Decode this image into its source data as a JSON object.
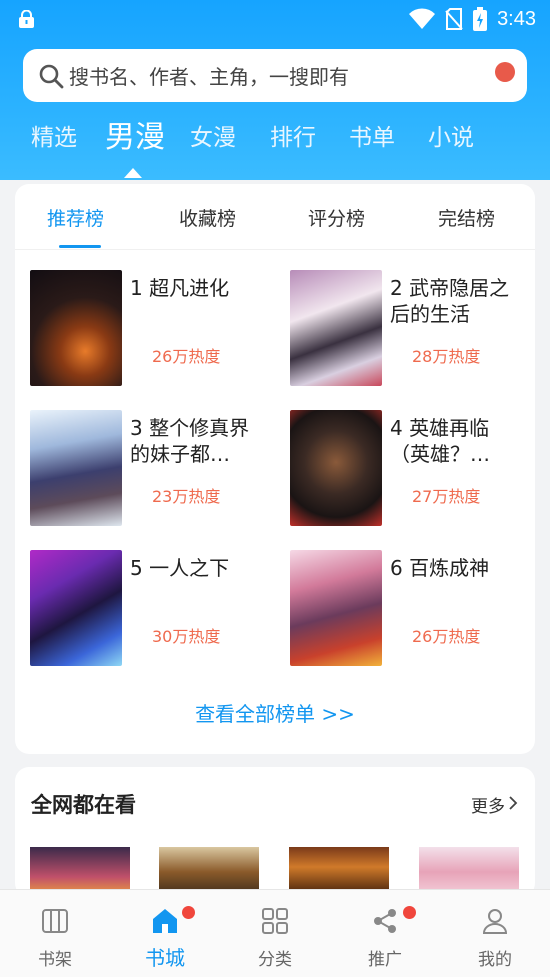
{
  "status_bar": {
    "time": "3:43"
  },
  "search": {
    "placeholder": "搜书名、作者、主角，一搜即有"
  },
  "top_tabs": [
    "精选",
    "男漫",
    "女漫",
    "排行",
    "书单",
    "小说"
  ],
  "rank_tabs": [
    "推荐榜",
    "收藏榜",
    "评分榜",
    "完结榜"
  ],
  "books": [
    {
      "rank": "1",
      "title": "超凡进化",
      "heat": "26万热度"
    },
    {
      "rank": "2",
      "title": "武帝隐居之后的生活",
      "heat": "28万热度"
    },
    {
      "rank": "3",
      "title": "整个修真界的妹子都…",
      "heat": "23万热度"
    },
    {
      "rank": "4",
      "title": "英雄再临（英雄？…",
      "heat": "27万热度"
    },
    {
      "rank": "5",
      "title": "一人之下",
      "heat": "30万热度"
    },
    {
      "rank": "6",
      "title": "百炼成神",
      "heat": "26万热度"
    }
  ],
  "view_all": "查看全部榜单 >>",
  "network": {
    "title": "全网都在看",
    "more": "更多"
  },
  "bottom_nav": [
    "书架",
    "书城",
    "分类",
    "推广",
    "我的"
  ],
  "colors": {
    "accent": "#1296f0",
    "header": "#16a4ff",
    "heat": "#ef6a4e",
    "badge": "#f0463c"
  }
}
